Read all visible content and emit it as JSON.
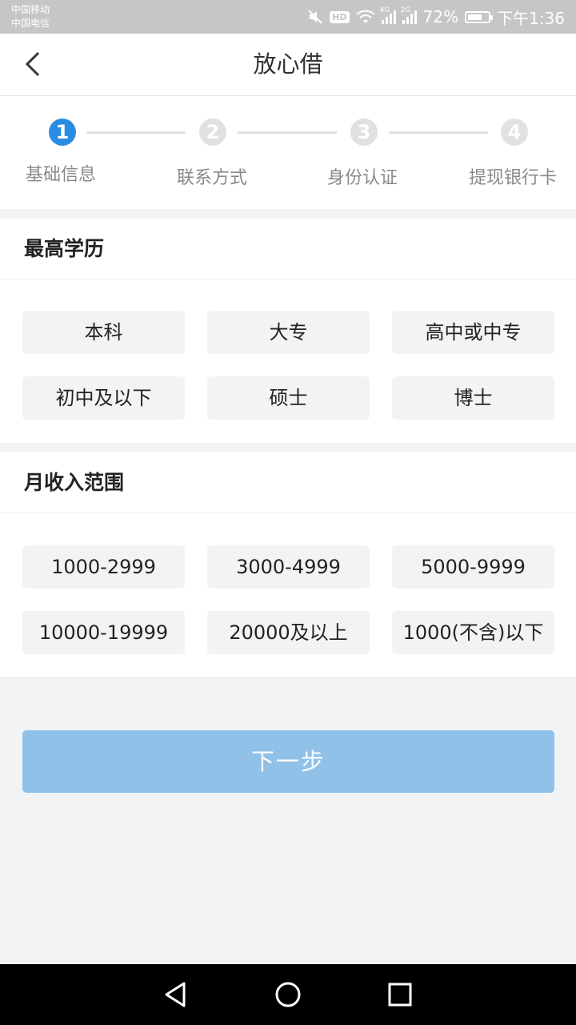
{
  "status_bar": {
    "carrier_1": "中国移动",
    "carrier_2": "中国电信",
    "hd": "HD",
    "net_1": "4G",
    "net_2": "2G",
    "battery": "72%",
    "battery_level": 0.72,
    "time": "下午1:36"
  },
  "header": {
    "title": "放心借"
  },
  "steps": [
    {
      "num": "1",
      "label": "基础信息",
      "active": true
    },
    {
      "num": "2",
      "label": "联系方式",
      "active": false
    },
    {
      "num": "3",
      "label": "身份认证",
      "active": false
    },
    {
      "num": "4",
      "label": "提现银行卡",
      "active": false
    }
  ],
  "education": {
    "title": "最高学历",
    "options": [
      "本科",
      "大专",
      "高中或中专",
      "初中及以下",
      "硕士",
      "博士"
    ]
  },
  "income": {
    "title": "月收入范围",
    "options": [
      "1000-2999",
      "3000-4999",
      "5000-9999",
      "10000-19999",
      "20000及以上",
      "1000(不含)以下"
    ]
  },
  "actions": {
    "next": "下一步"
  },
  "colors": {
    "accent": "#2a8ce0",
    "button": "#8fc1e9",
    "background": "#f2f3f5"
  },
  "icons": {
    "back": "chevron-left-icon",
    "nav_back": "triangle-back-icon",
    "home": "circle-home-icon",
    "recents": "square-recents-icon"
  }
}
